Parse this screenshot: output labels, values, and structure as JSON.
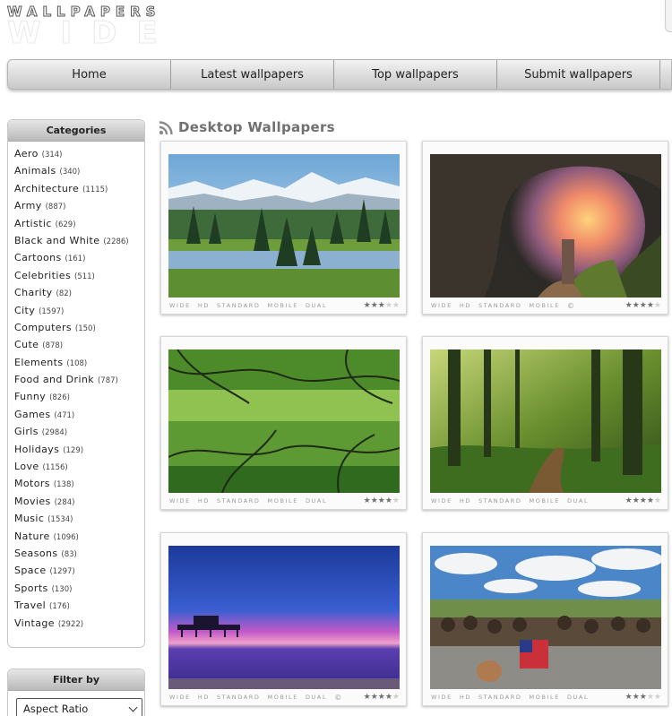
{
  "logo": {
    "top": "WALLPAPERS",
    "big": "WIDE"
  },
  "nav": [
    {
      "label": "Home"
    },
    {
      "label": "Latest wallpapers"
    },
    {
      "label": "Top wallpapers"
    },
    {
      "label": "Submit wallpapers"
    }
  ],
  "categories": {
    "title": "Categories",
    "items": [
      {
        "name": "Aero",
        "count": "(314)"
      },
      {
        "name": "Animals",
        "count": "(340)"
      },
      {
        "name": "Architecture",
        "count": "(1115)"
      },
      {
        "name": "Army",
        "count": "(887)"
      },
      {
        "name": "Artistic",
        "count": "(629)"
      },
      {
        "name": "Black and White",
        "count": "(2286)"
      },
      {
        "name": "Cartoons",
        "count": "(161)"
      },
      {
        "name": "Celebrities",
        "count": "(511)"
      },
      {
        "name": "Charity",
        "count": "(82)"
      },
      {
        "name": "City",
        "count": "(1597)"
      },
      {
        "name": "Computers",
        "count": "(150)"
      },
      {
        "name": "Cute",
        "count": "(878)"
      },
      {
        "name": "Elements",
        "count": "(108)"
      },
      {
        "name": "Food and Drink",
        "count": "(787)"
      },
      {
        "name": "Funny",
        "count": "(826)"
      },
      {
        "name": "Games",
        "count": "(471)"
      },
      {
        "name": "Girls",
        "count": "(2984)"
      },
      {
        "name": "Holidays",
        "count": "(129)"
      },
      {
        "name": "Love",
        "count": "(1156)"
      },
      {
        "name": "Motors",
        "count": "(138)"
      },
      {
        "name": "Movies",
        "count": "(284)"
      },
      {
        "name": "Music",
        "count": "(1534)"
      },
      {
        "name": "Nature",
        "count": "(1096)"
      },
      {
        "name": "Seasons",
        "count": "(83)"
      },
      {
        "name": "Space",
        "count": "(1297)"
      },
      {
        "name": "Sports",
        "count": "(130)"
      },
      {
        "name": "Travel",
        "count": "(176)"
      },
      {
        "name": "Vintage",
        "count": "(2922)"
      }
    ]
  },
  "filter": {
    "title": "Filter by",
    "select_value": "Aspect Ratio"
  },
  "main": {
    "title": "Desktop Wallpapers",
    "cards": [
      {
        "scene": "mountain-lake",
        "formats": [
          "WIDE",
          "HD",
          "STANDARD",
          "MOBILE",
          "DUAL"
        ],
        "extra": "",
        "rating": 3
      },
      {
        "scene": "cave-sunset",
        "formats": [
          "WIDE",
          "HD",
          "STANDARD",
          "MOBILE"
        ],
        "extra": "©",
        "rating": 4
      },
      {
        "scene": "green-river",
        "formats": [
          "WIDE",
          "HD",
          "STANDARD",
          "MOBILE",
          "DUAL"
        ],
        "extra": "",
        "rating": 4
      },
      {
        "scene": "forest-path",
        "formats": [
          "WIDE",
          "HD",
          "STANDARD",
          "MOBILE",
          "DUAL"
        ],
        "extra": "",
        "rating": 4
      },
      {
        "scene": "pier-sunset",
        "formats": [
          "WIDE",
          "HD",
          "STANDARD",
          "MOBILE",
          "DUAL"
        ],
        "extra": "©",
        "rating": 4
      },
      {
        "scene": "game-last-supper",
        "formats": [
          "WIDE",
          "HD",
          "STANDARD",
          "MOBILE",
          "DUAL"
        ],
        "extra": "",
        "rating": 3
      }
    ]
  },
  "colors": {
    "nav_top": "#f2f2f2",
    "nav_bottom": "#c9c9c9",
    "heading": "#707070",
    "star_on": "#6f6f6f",
    "star_off": "#d0d0d0"
  }
}
